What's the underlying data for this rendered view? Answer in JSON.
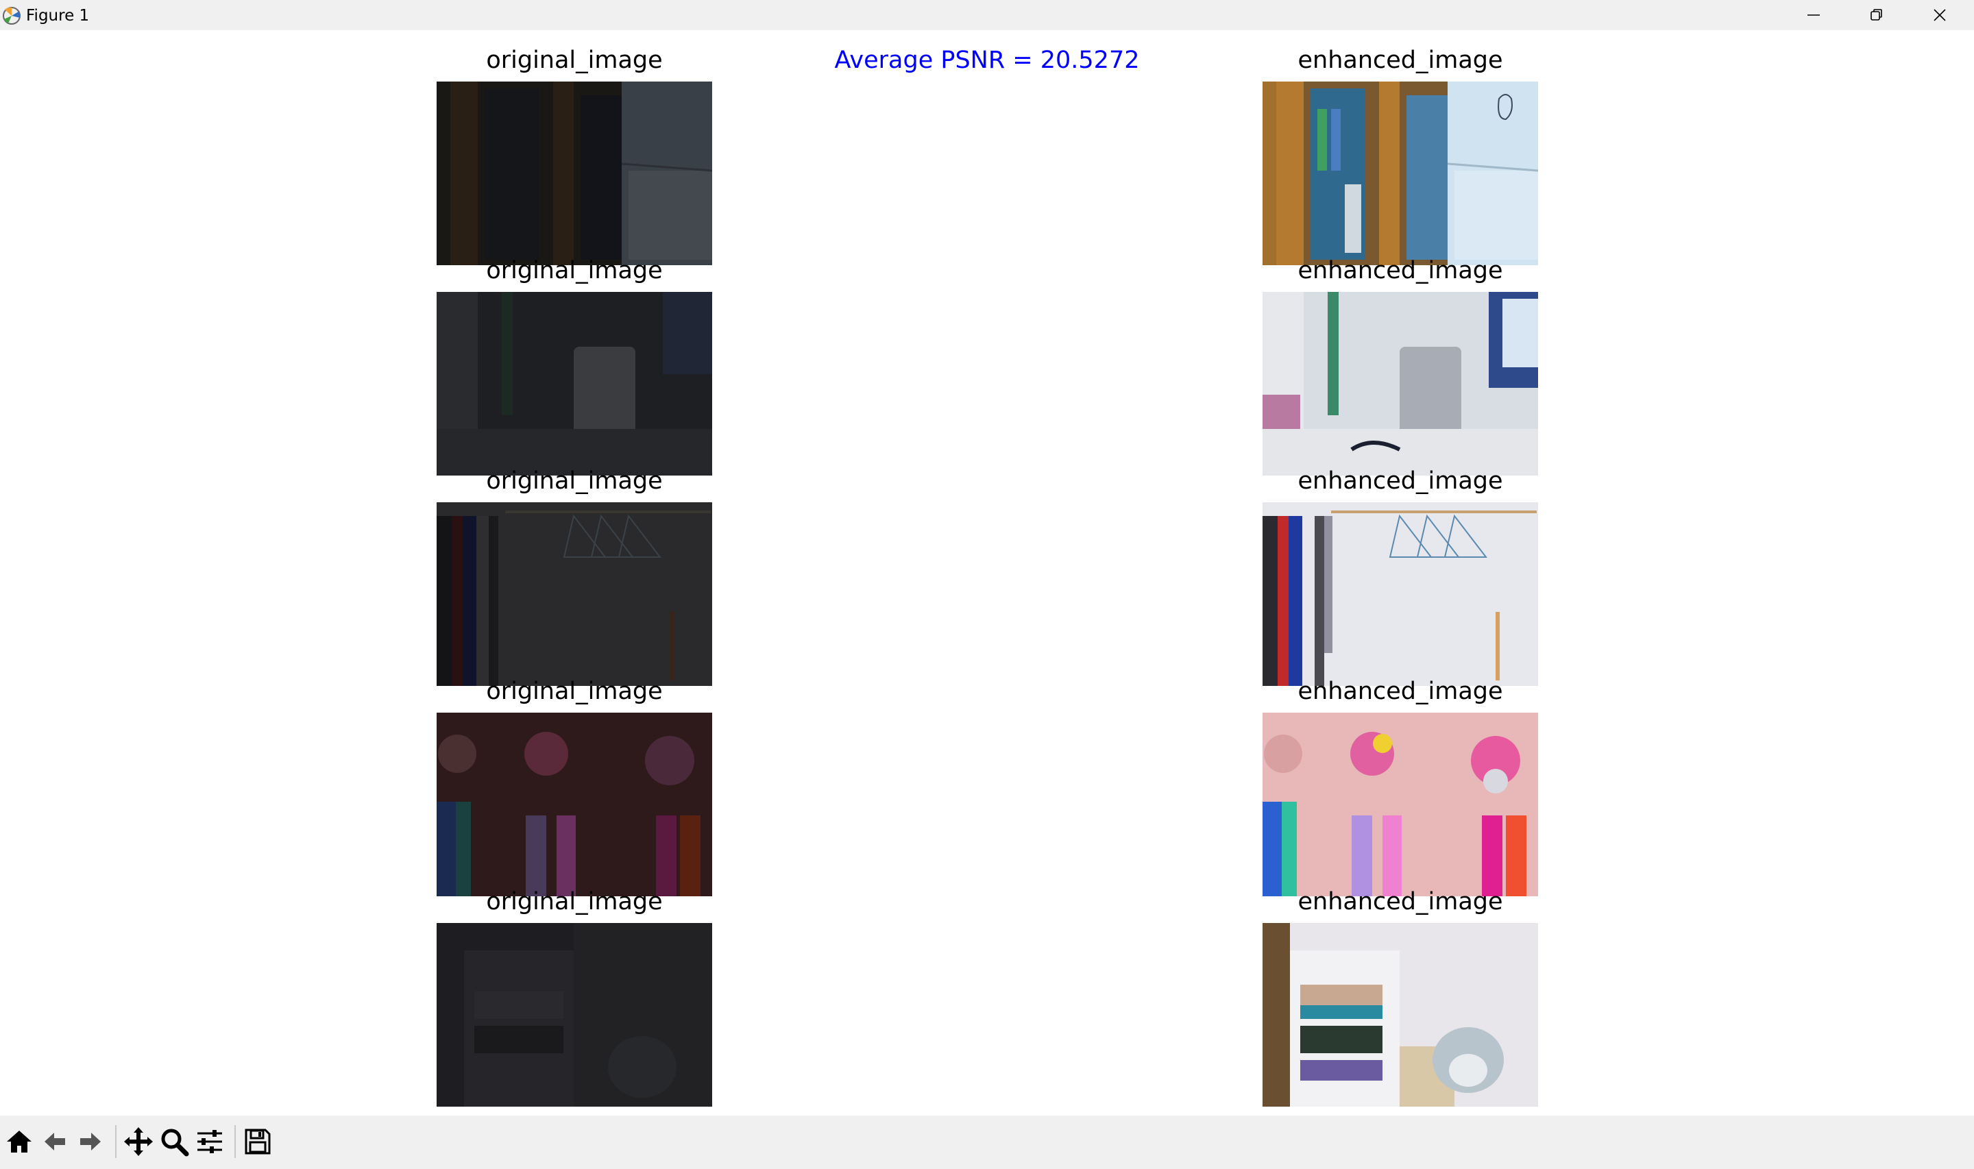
{
  "window": {
    "title": "Figure 1",
    "controls": [
      "minimize",
      "restore",
      "close"
    ]
  },
  "figure": {
    "suptitle": "Average PSNR = 20.5272",
    "suptitle_color": "#0000ff",
    "rows": [
      {
        "left_title": "original_image",
        "right_title": "enhanced_image",
        "scene": "bookshelf"
      },
      {
        "left_title": "original_image",
        "right_title": "enhanced_image",
        "scene": "utensil-holder"
      },
      {
        "left_title": "original_image",
        "right_title": "enhanced_image",
        "scene": "wardrobe"
      },
      {
        "left_title": "original_image",
        "right_title": "enhanced_image",
        "scene": "tassel-ornaments"
      },
      {
        "left_title": "original_image",
        "right_title": "enhanced_image",
        "scene": "plush-toy-shelf"
      }
    ]
  },
  "toolbar": {
    "tools": [
      "home-icon",
      "back-arrow-icon",
      "forward-arrow-icon",
      "pan-icon",
      "zoom-icon",
      "configure-subplots-icon",
      "save-icon"
    ]
  }
}
